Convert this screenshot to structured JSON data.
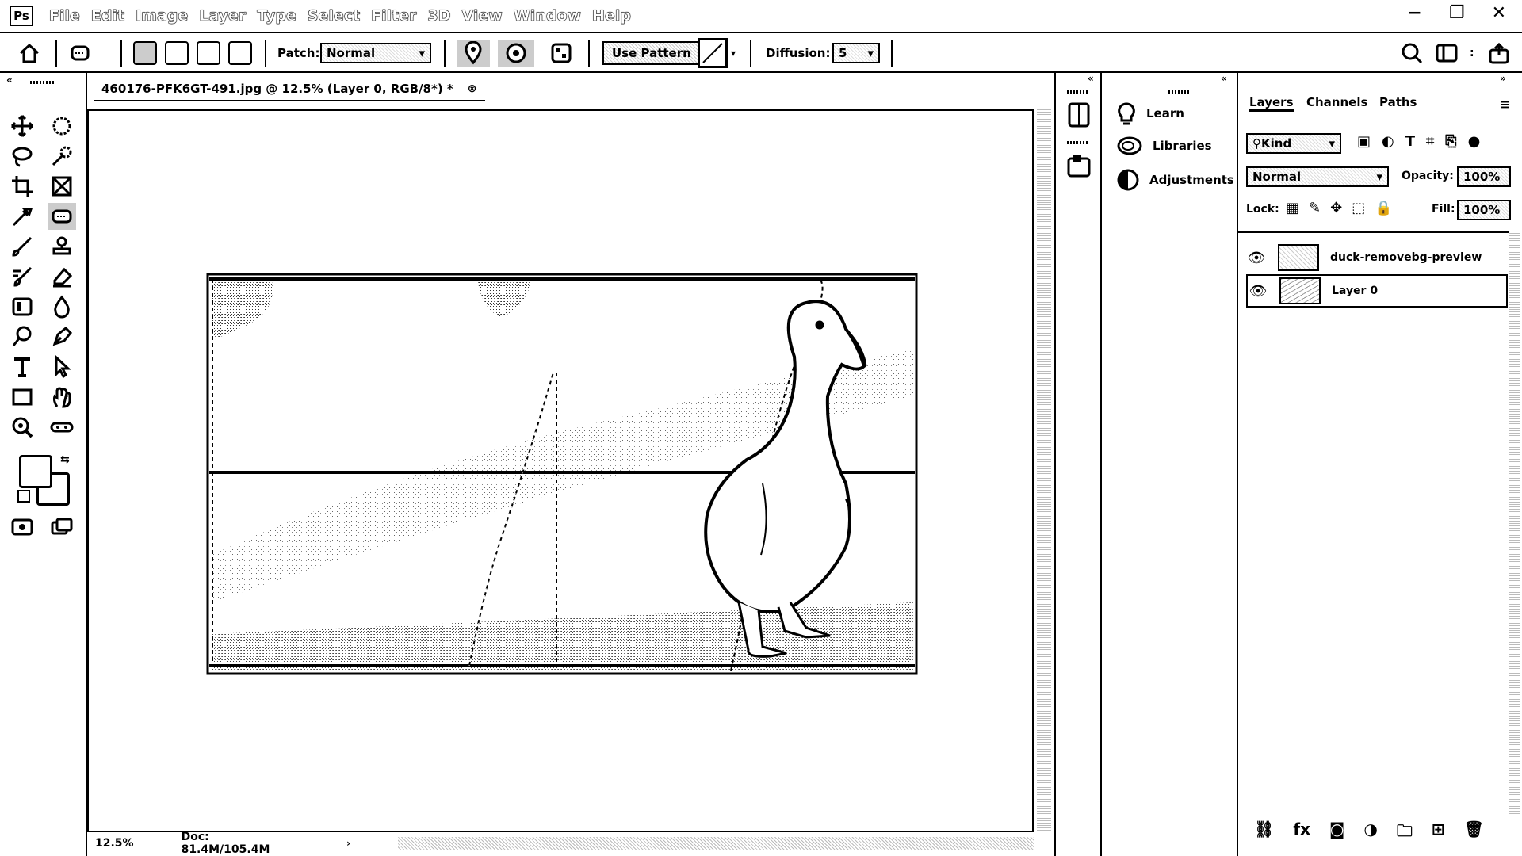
{
  "app": {
    "logo": "Ps"
  },
  "menu": [
    "File",
    "Edit",
    "Image",
    "Layer",
    "Type",
    "Select",
    "Filter",
    "3D",
    "View",
    "Window",
    "Help"
  ],
  "window_controls": {
    "minimize": "−",
    "restore": "❐",
    "close": "✕"
  },
  "options": {
    "patch_label": "Patch:",
    "patch_value": "Normal",
    "use_pattern_label": "Use Pattern",
    "diffusion_label": "Diffusion:",
    "diffusion_value": "5"
  },
  "document": {
    "tab_title": "460176-PFK6GT-491.jpg @ 12.5% (Layer 0, RGB/8*) *",
    "zoom": "12.5%",
    "doc_size": "Doc: 81.4M/105.4M"
  },
  "side_panel": {
    "items": [
      {
        "label": "Learn",
        "icon": "lightbulb-icon"
      },
      {
        "label": "Libraries",
        "icon": "cloud-icon"
      },
      {
        "label": "Adjustments",
        "icon": "adjust-icon"
      }
    ]
  },
  "layers_panel": {
    "tabs": [
      "Layers",
      "Channels",
      "Paths"
    ],
    "filter_kind": "Kind",
    "blend_mode": "Normal",
    "opacity_label": "Opacity:",
    "opacity_value": "100%",
    "lock_label": "Lock:",
    "fill_label": "Fill:",
    "fill_value": "100%",
    "layers": [
      {
        "name": "duck-removebg-preview",
        "visible": true,
        "selected": false
      },
      {
        "name": "Layer 0",
        "visible": true,
        "selected": true
      }
    ]
  }
}
